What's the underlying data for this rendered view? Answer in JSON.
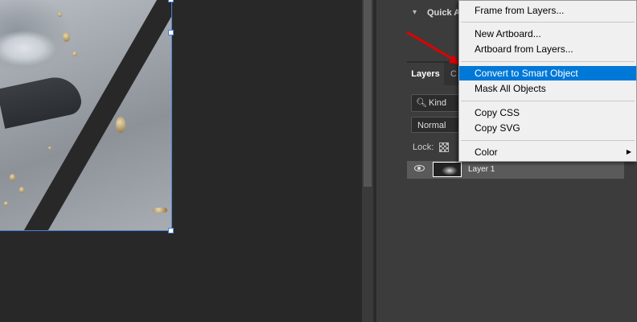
{
  "quick_actions": {
    "label": "Quick A",
    "chevron": "▾"
  },
  "layers_panel": {
    "tab_label": "Layers",
    "next_tab_label": "C",
    "filter": {
      "icon": "search-icon",
      "value": "Kind"
    },
    "blend_mode": "Normal",
    "lock_label": "Lock:",
    "layers": [
      {
        "name": "Layer 1",
        "visible": true
      }
    ]
  },
  "context_menu": {
    "items": [
      {
        "label": "Frame from Layers..."
      },
      {
        "label": "New Artboard..."
      },
      {
        "label": "Artboard from Layers..."
      },
      {
        "label": "Convert to Smart Object",
        "highlighted": true
      },
      {
        "label": "Mask All Objects"
      },
      {
        "label": "Copy CSS"
      },
      {
        "label": "Copy SVG"
      },
      {
        "label": "Color",
        "submenu": true
      }
    ],
    "submenu_arrow": "▶"
  },
  "colors": {
    "highlight": "#0078d7",
    "selection": "#4a7fd6",
    "annotation_arrow": "#e00000",
    "panel_bg": "#3c3c3c",
    "canvas_bg": "#282828"
  }
}
